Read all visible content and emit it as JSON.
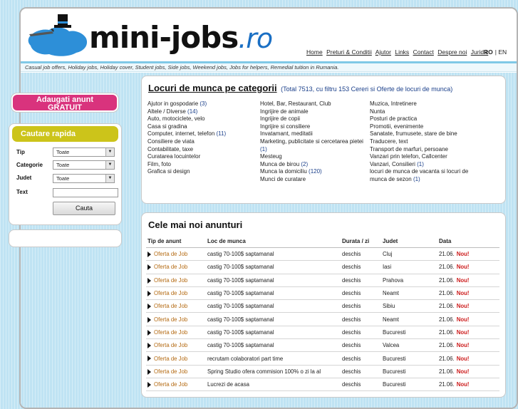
{
  "header": {
    "logo_main": "mini-jobs",
    "logo_domain": ".ro",
    "nav": [
      "Home",
      "Preturi & Conditii",
      "Ajutor",
      "Links",
      "Contact",
      "Despre noi",
      "Juridic"
    ],
    "lang_active": "RO",
    "lang_other": "EN",
    "tagline": "Casual job offers, Holiday jobs, Holiday cover, Student jobs, Side jobs, Weekend jobs, Jobs for helpers, Remedial tuition in Rumania."
  },
  "sidebar": {
    "add_button_line1": "Adaugati anunt",
    "add_button_line2": "GRATUIT",
    "search_title": "Cautare rapida",
    "labels": {
      "tip": "Tip",
      "categorie": "Categorie",
      "judet": "Judet",
      "text": "Text"
    },
    "selects": {
      "tip": "Toate",
      "categorie": "Toate",
      "judet": "Toate"
    },
    "search_button": "Cauta",
    "colors": {
      "add": "#d9337d",
      "search": "#ccc41a"
    }
  },
  "categories": {
    "title": "Locuri de munca pe categorii",
    "subtitle": "(Total 7513, cu filtru 153 Cereri si Oferte de locuri de munca)",
    "col1": [
      {
        "label": "Ajutor in gospodarie",
        "count": "(3)"
      },
      {
        "label": "Altele / Diverse",
        "count": "(14)"
      },
      {
        "label": "Auto, motociclete, velo",
        "count": ""
      },
      {
        "label": "Casa si gradina",
        "count": ""
      },
      {
        "label": "Computer, internet, telefon",
        "count": "(11)"
      },
      {
        "label": "Consiliere de viata",
        "count": ""
      },
      {
        "label": "Contabilitate, taxe",
        "count": ""
      },
      {
        "label": "Curatarea locuintelor",
        "count": ""
      },
      {
        "label": "Film, foto",
        "count": ""
      },
      {
        "label": "Grafica si design",
        "count": ""
      }
    ],
    "col2": [
      {
        "label": "Hotel, Bar, Restaurant, Club",
        "count": ""
      },
      {
        "label": "Ingrijire de animale",
        "count": ""
      },
      {
        "label": "Ingrijire de copii",
        "count": ""
      },
      {
        "label": "Ingrijire si consiliere",
        "count": ""
      },
      {
        "label": "Invatamant, meditatii",
        "count": ""
      },
      {
        "label": "Marketing, publicitate si cercetarea pietei",
        "count": "(1)"
      },
      {
        "label": "Mesteug",
        "count": ""
      },
      {
        "label": "Munca de birou",
        "count": "(2)"
      },
      {
        "label": "Munca la domiciliu",
        "count": "(120)"
      },
      {
        "label": "Munci de curatare",
        "count": ""
      }
    ],
    "col3": [
      {
        "label": "Muzica, Intretinere",
        "count": ""
      },
      {
        "label": "Nunta",
        "count": ""
      },
      {
        "label": "Posturi de practica",
        "count": ""
      },
      {
        "label": "Promotii, evenimente",
        "count": ""
      },
      {
        "label": "Sanatate, frumusete, stare de bine",
        "count": ""
      },
      {
        "label": "Traducere, text",
        "count": ""
      },
      {
        "label": "Transport de marfuri, persoane",
        "count": ""
      },
      {
        "label": "Vanzari prin telefon, Callcenter",
        "count": ""
      },
      {
        "label": "Vanzari, Consilieri",
        "count": "(1)"
      },
      {
        "label": "locuri de munca de vacanta si locuri de munca de sezon",
        "count": "(1)"
      }
    ]
  },
  "listings": {
    "title": "Cele mai noi anunturi",
    "headers": [
      "Tip de anunt",
      "Loc de munca",
      "Durata / zi",
      "Judet",
      "Data"
    ],
    "rows": [
      {
        "type": "Oferta de Job",
        "job": "castig 70-100$ saptamanal",
        "durata": "deschis",
        "judet": "Cluj",
        "data": "21.06.",
        "badge": "Nou!"
      },
      {
        "type": "Oferta de Job",
        "job": "castig 70-100$ saptamanal",
        "durata": "deschis",
        "judet": "Iasi",
        "data": "21.06.",
        "badge": "Nou!"
      },
      {
        "type": "Oferta de Job",
        "job": "castig 70-100$ saptamanal",
        "durata": "deschis",
        "judet": "Prahova",
        "data": "21.06.",
        "badge": "Nou!"
      },
      {
        "type": "Oferta de Job",
        "job": "castig 70-100$ saptamanal",
        "durata": "deschis",
        "judet": "Neamt",
        "data": "21.06.",
        "badge": "Nou!"
      },
      {
        "type": "Oferta de Job",
        "job": "castig 70-100$ saptamanal",
        "durata": "deschis",
        "judet": "Sibiu",
        "data": "21.06.",
        "badge": "Nou!"
      },
      {
        "type": "Oferta de Job",
        "job": "castig 70-100$ saptamanal",
        "durata": "deschis",
        "judet": "Neamt",
        "data": "21.06.",
        "badge": "Nou!"
      },
      {
        "type": "Oferta de Job",
        "job": "castig 70-100$ saptamanal",
        "durata": "deschis",
        "judet": "Bucuresti",
        "data": "21.06.",
        "badge": "Nou!"
      },
      {
        "type": "Oferta de Job",
        "job": "castig 70-100$ saptamanal",
        "durata": "deschis",
        "judet": "Valcea",
        "data": "21.06.",
        "badge": "Nou!"
      },
      {
        "type": "Oferta de Job",
        "job": "recrutam colaboratori part time",
        "durata": "deschis",
        "judet": "Bucuresti",
        "data": "21.06.",
        "badge": "Nou!"
      },
      {
        "type": "Oferta de Job",
        "job": "Spring Studio ofera commision 100% o zi la al",
        "durata": "deschis",
        "judet": "Bucuresti",
        "data": "21.06.",
        "badge": "Nou!"
      },
      {
        "type": "Oferta de Job",
        "job": "Lucrezi de acasa",
        "durata": "deschis",
        "judet": "Bucuresti",
        "data": "21.06.",
        "badge": "Nou!"
      }
    ]
  }
}
